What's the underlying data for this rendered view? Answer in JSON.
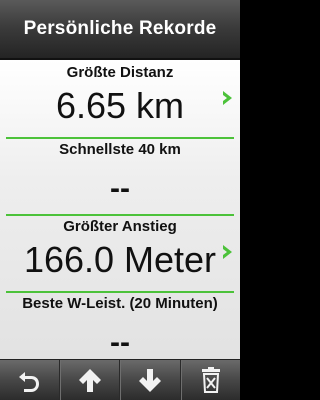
{
  "header": {
    "title": "Persönliche Rekorde"
  },
  "records": [
    {
      "label": "Größte Distanz",
      "value": "6.65 km",
      "has_detail": true
    },
    {
      "label": "Schnellste 40 km",
      "value": "--",
      "has_detail": false
    },
    {
      "label": "Größter Anstieg",
      "value": "166.0 Meter",
      "has_detail": true
    },
    {
      "label": "Beste W-Leist. (20 Minuten)",
      "value": "--",
      "has_detail": false
    }
  ],
  "toolbar": {
    "buttons": [
      {
        "name": "back",
        "icon": "back-arrow-icon"
      },
      {
        "name": "scroll-up",
        "icon": "arrow-up-icon"
      },
      {
        "name": "scroll-down",
        "icon": "arrow-down-icon"
      },
      {
        "name": "delete",
        "icon": "trash-icon"
      }
    ]
  },
  "colors": {
    "accent": "#4cc23a",
    "title_bar": "#3c3c3c",
    "background": "#e9e9e9"
  }
}
